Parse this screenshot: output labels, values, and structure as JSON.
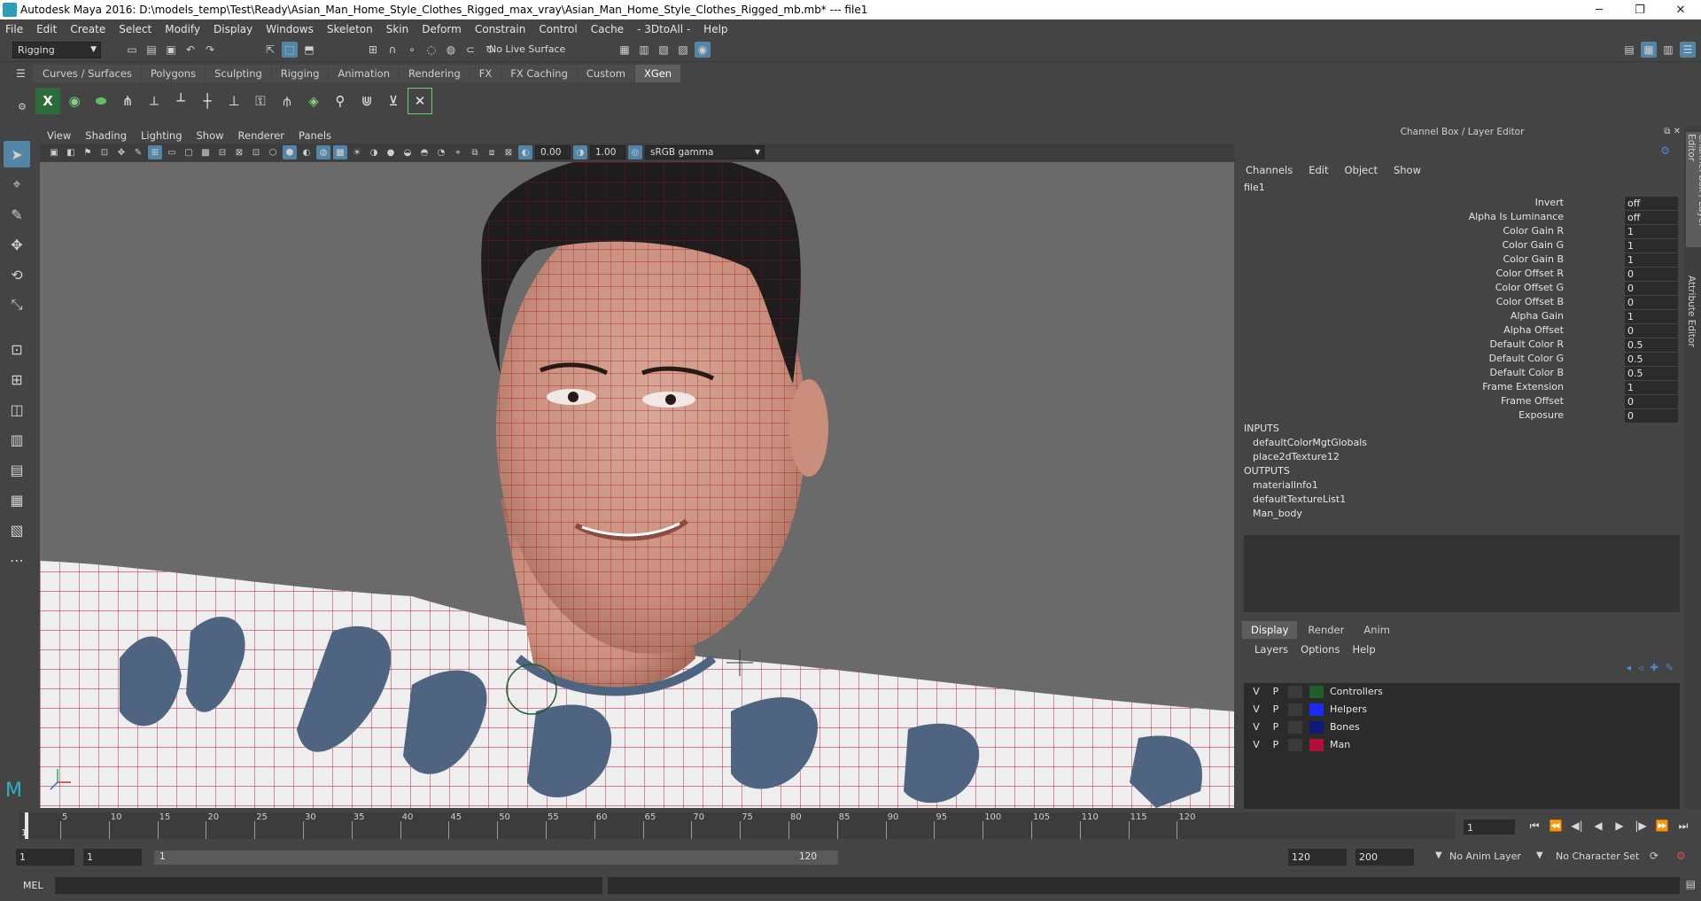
{
  "title_bar": {
    "text": "Autodesk Maya 2016: D:\\models_temp\\Test\\Ready\\Asian_Man_Home_Style_Clothes_Rigged_max_vray\\Asian_Man_Home_Style_Clothes_Rigged_mb.mb*   ---   file1",
    "minimize": "─",
    "restore": "❐",
    "close": "✕"
  },
  "menubar": [
    "File",
    "Edit",
    "Create",
    "Select",
    "Modify",
    "Display",
    "Windows",
    "Skeleton",
    "Skin",
    "Deform",
    "Constrain",
    "Control",
    "Cache",
    "- 3DtoAll -",
    "Help"
  ],
  "status_line": {
    "mode_dropdown": "Rigging",
    "live_surface": "No Live Surface"
  },
  "shelf": {
    "tabs": [
      "Curves / Surfaces",
      "Polygons",
      "Sculpting",
      "Rigging",
      "Animation",
      "Rendering",
      "FX",
      "FX Caching",
      "Custom",
      "XGen"
    ],
    "active_tab": "XGen"
  },
  "viewport": {
    "menu": [
      "View",
      "Shading",
      "Lighting",
      "Show",
      "Renderer",
      "Panels"
    ],
    "exposure": "0.00",
    "gamma": "1.00",
    "color_space": "sRGB gamma"
  },
  "channel_box": {
    "title": "Channel Box / Layer Editor",
    "menu": [
      "Channels",
      "Edit",
      "Object",
      "Show"
    ],
    "node": "file1",
    "attributes": [
      {
        "label": "Invert",
        "value": "off"
      },
      {
        "label": "Alpha Is Luminance",
        "value": "off"
      },
      {
        "label": "Color Gain R",
        "value": "1"
      },
      {
        "label": "Color Gain G",
        "value": "1"
      },
      {
        "label": "Color Gain B",
        "value": "1"
      },
      {
        "label": "Color Offset R",
        "value": "0"
      },
      {
        "label": "Color Offset G",
        "value": "0"
      },
      {
        "label": "Color Offset B",
        "value": "0"
      },
      {
        "label": "Alpha Gain",
        "value": "1"
      },
      {
        "label": "Alpha Offset",
        "value": "0"
      },
      {
        "label": "Default Color R",
        "value": "0.5"
      },
      {
        "label": "Default Color G",
        "value": "0.5"
      },
      {
        "label": "Default Color B",
        "value": "0.5"
      },
      {
        "label": "Frame Extension",
        "value": "1"
      },
      {
        "label": "Frame Offset",
        "value": "0"
      },
      {
        "label": "Exposure",
        "value": "0"
      }
    ],
    "inputs_header": "INPUTS",
    "inputs": [
      "defaultColorMgtGlobals",
      "place2dTexture12"
    ],
    "outputs_header": "OUTPUTS",
    "outputs": [
      "materialInfo1",
      "defaultTextureList1",
      "Man_body"
    ]
  },
  "layer_editor": {
    "tabs": [
      "Display",
      "Render",
      "Anim"
    ],
    "active_tab": "Display",
    "menu": [
      "Layers",
      "Options",
      "Help"
    ],
    "layers": [
      {
        "v": "V",
        "p": "P",
        "name": "Controllers",
        "color": "#1f5e2e"
      },
      {
        "v": "V",
        "p": "P",
        "name": "Helpers",
        "color": "#1b2cf0"
      },
      {
        "v": "V",
        "p": "P",
        "name": "Bones",
        "color": "#101a78"
      },
      {
        "v": "V",
        "p": "P",
        "name": "Man",
        "color": "#b01035"
      }
    ]
  },
  "side_tabs": [
    "Channel Box / Layer Editor",
    "Attribute Editor"
  ],
  "timeline": {
    "ticks": [
      "5",
      "10",
      "15",
      "20",
      "25",
      "30",
      "35",
      "40",
      "45",
      "50",
      "55",
      "60",
      "65",
      "70",
      "75",
      "80",
      "85",
      "90",
      "95",
      "100",
      "105",
      "110",
      "115",
      "120"
    ],
    "current_frame": "1",
    "current_marker": "1"
  },
  "range": {
    "start": "1",
    "playback_start": "1",
    "slider_start": "1",
    "slider_end": "120",
    "playback_end": "120",
    "end": "200",
    "anim_layer": "No Anim Layer",
    "character_set": "No Character Set"
  },
  "command_line": {
    "label": "MEL"
  },
  "colors": {
    "accent": "#5285a6",
    "wireframe": "#b0122e",
    "active_shelf": "#5d5d5d"
  }
}
